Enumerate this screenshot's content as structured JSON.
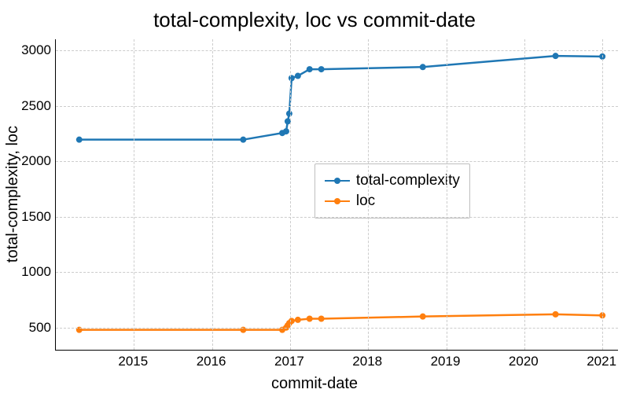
{
  "chart_data": {
    "type": "line",
    "title": "total-complexity, loc vs commit-date",
    "xlabel": "commit-date",
    "ylabel": "total-complexity, loc",
    "x_ticks": [
      2015,
      2016,
      2017,
      2018,
      2019,
      2020,
      2021
    ],
    "y_ticks": [
      500,
      1000,
      1500,
      2000,
      2500,
      3000
    ],
    "xlim": [
      2014.0,
      2021.2
    ],
    "ylim": [
      300,
      3100
    ],
    "series": [
      {
        "name": "total-complexity",
        "color": "#1f77b4",
        "x": [
          2014.3,
          2016.4,
          2016.9,
          2016.95,
          2016.97,
          2016.99,
          2017.02,
          2017.1,
          2017.25,
          2017.4,
          2018.7,
          2020.4,
          2021.0
        ],
        "y": [
          2195,
          2195,
          2255,
          2270,
          2360,
          2430,
          2750,
          2770,
          2830,
          2830,
          2850,
          2950,
          2945
        ]
      },
      {
        "name": "loc",
        "color": "#ff7f0e",
        "x": [
          2014.3,
          2016.4,
          2016.9,
          2016.95,
          2016.97,
          2016.99,
          2017.02,
          2017.1,
          2017.25,
          2017.4,
          2018.7,
          2020.4,
          2021.0
        ],
        "y": [
          480,
          480,
          480,
          500,
          520,
          540,
          560,
          570,
          580,
          580,
          600,
          620,
          610
        ]
      }
    ],
    "legend_position": {
      "left_frac": 0.46,
      "top_frac": 0.4
    }
  }
}
